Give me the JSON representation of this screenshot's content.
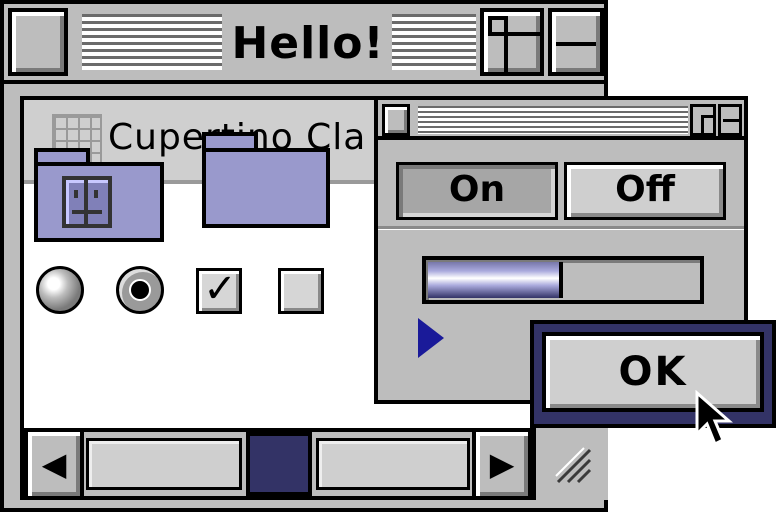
{
  "main_window": {
    "title": "Hello!",
    "content_title": "Cupertino Cla"
  },
  "icons": {
    "grid": "grid-icon",
    "finder_folder": "finder-folder-icon",
    "plain_folder": "folder-icon",
    "scroll_left": "◀",
    "scroll_right": "▶",
    "grow": "////"
  },
  "controls": {
    "radio_unselected": false,
    "radio_selected": true,
    "checkbox_checked": true,
    "checkbox_unchecked": false,
    "check_mark": "✓"
  },
  "dialog": {
    "segment_on_label": "On",
    "segment_off_label": "Off",
    "segment_selected": "On",
    "progress_fraction": 0.5
  },
  "ok_button": {
    "label": "OK"
  },
  "colors": {
    "accent": "#333366",
    "folder": "#9999cc",
    "disclosure": "#1a1a99",
    "chrome": "#bdbdbd"
  }
}
